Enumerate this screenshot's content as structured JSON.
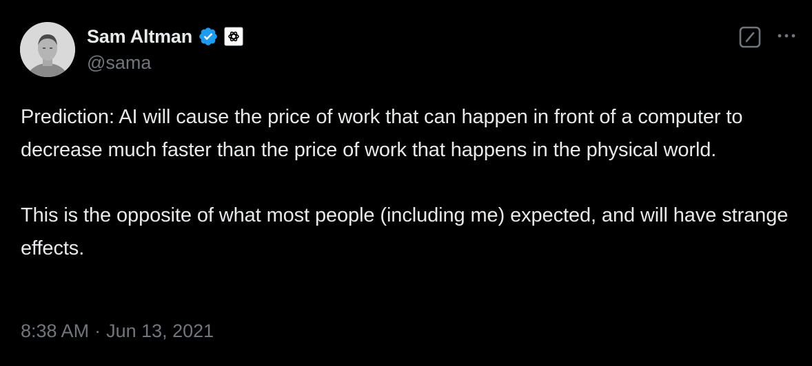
{
  "author": {
    "display_name": "Sam Altman",
    "handle": "@sama",
    "verified_color": "#1d9bf0"
  },
  "icons": {
    "verified": "verified-badge-icon",
    "affiliate": "openai-affiliate-icon",
    "grok": "grok-icon",
    "more": "more-options-icon"
  },
  "tweet": {
    "paragraphs": [
      "Prediction: AI will cause the price of work that can happen in front of a computer to decrease much faster than the price of work that happens in the physical world.",
      "This is the opposite of what most people (including me) expected, and will have strange effects."
    ],
    "time": "8:38 AM",
    "separator": "·",
    "date": "Jun 13, 2021"
  },
  "colors": {
    "background": "#000000",
    "text": "#e7e9ea",
    "secondary_text": "#71767b"
  }
}
